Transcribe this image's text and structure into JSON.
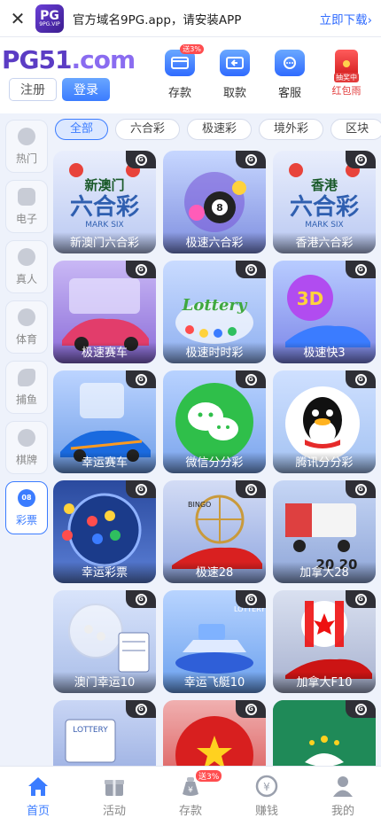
{
  "banner": {
    "close": "✕",
    "app_logo_big": "PG",
    "app_logo_small": "9PG.VIP",
    "text": "官方域名9PG.app，请安装APP",
    "download": "立即下载›"
  },
  "header": {
    "logo_main": "PG51",
    "logo_suffix": ".com",
    "register": "注册",
    "login": "登录",
    "icons": [
      {
        "label": "存款",
        "badge": "送3%"
      },
      {
        "label": "取款"
      },
      {
        "label": "客服"
      },
      {
        "label": "红包雨",
        "tag": "抽奖中"
      }
    ]
  },
  "sidebar": [
    {
      "label": "热门"
    },
    {
      "label": "电子"
    },
    {
      "label": "真人"
    },
    {
      "label": "体育"
    },
    {
      "label": "捕鱼"
    },
    {
      "label": "棋牌"
    },
    {
      "label": "彩票",
      "badge": "08"
    }
  ],
  "tabs": [
    "全部",
    "六合彩",
    "极速彩",
    "境外彩",
    "区块"
  ],
  "games": [
    {
      "name": "新澳门六合彩",
      "art_text": "新澳门",
      "art_big": "六合彩",
      "art_sub": "MARK SIX"
    },
    {
      "name": "极速六合彩",
      "art_text": "8"
    },
    {
      "name": "香港六合彩",
      "art_text": "香港",
      "art_big": "六合彩",
      "art_sub": "MARK SIX"
    },
    {
      "name": "极速赛车"
    },
    {
      "name": "极速时时彩",
      "art_text": "Lottery"
    },
    {
      "name": "极速快3",
      "art_text": "3D"
    },
    {
      "name": "幸运赛车"
    },
    {
      "name": "微信分分彩"
    },
    {
      "name": "腾讯分分彩"
    },
    {
      "name": "幸运彩票"
    },
    {
      "name": "极速28",
      "art_text": "BINGO"
    },
    {
      "name": "加拿大28",
      "art_text": "20 20"
    },
    {
      "name": "澳门幸运10"
    },
    {
      "name": "幸运飞艇10",
      "art_text": "LOTTERY"
    },
    {
      "name": "加拿大F10"
    },
    {
      "name": "",
      "art_text": "LOTTERY"
    },
    {
      "name": ""
    },
    {
      "name": ""
    }
  ],
  "bottom_nav": [
    {
      "label": "首页"
    },
    {
      "label": "活动"
    },
    {
      "label": "存款",
      "badge": "送3%"
    },
    {
      "label": "赚钱"
    },
    {
      "label": "我的"
    }
  ],
  "colors": {
    "accent": "#3b7cff",
    "brand": "#5b3cc4"
  }
}
